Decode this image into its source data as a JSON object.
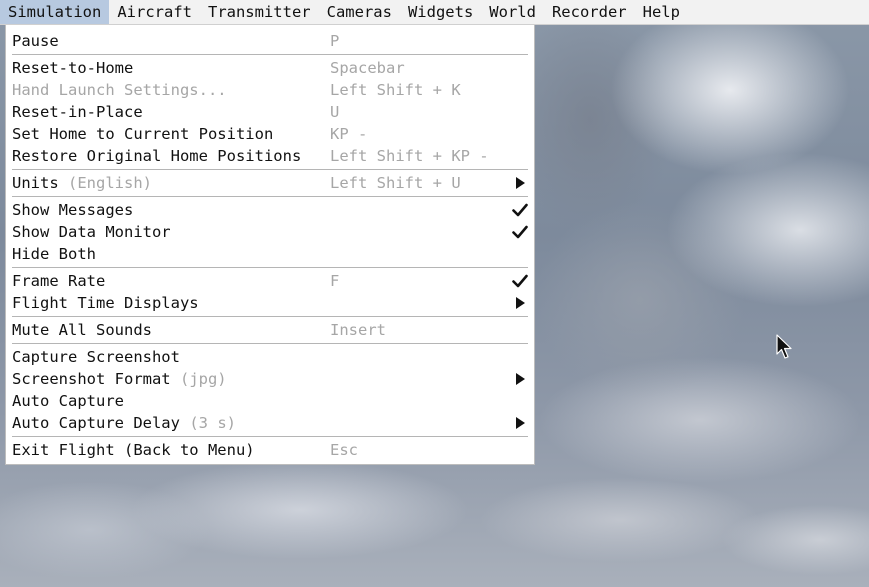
{
  "menubar": {
    "items": [
      {
        "label": "Simulation"
      },
      {
        "label": "Aircraft"
      },
      {
        "label": "Transmitter"
      },
      {
        "label": "Cameras"
      },
      {
        "label": "Widgets"
      },
      {
        "label": "World"
      },
      {
        "label": "Recorder"
      },
      {
        "label": "Help"
      }
    ]
  },
  "menu": {
    "pause": {
      "label": "Pause",
      "shortcut": "P"
    },
    "reset_home": {
      "label": "Reset-to-Home",
      "shortcut": "Spacebar"
    },
    "hand_launch": {
      "label": "Hand Launch Settings...",
      "shortcut": "Left Shift + K"
    },
    "reset_place": {
      "label": "Reset-in-Place",
      "shortcut": "U"
    },
    "set_home": {
      "label": "Set Home to Current Position",
      "shortcut": "KP -"
    },
    "restore_home": {
      "label": "Restore Original Home Positions",
      "shortcut": "Left Shift + KP -"
    },
    "units": {
      "label": "Units",
      "note": "(English)",
      "shortcut": "Left Shift + U"
    },
    "show_messages": {
      "label": "Show Messages"
    },
    "show_data_monitor": {
      "label": "Show Data Monitor"
    },
    "hide_both": {
      "label": "Hide Both"
    },
    "frame_rate": {
      "label": "Frame Rate",
      "shortcut": "F"
    },
    "flight_time": {
      "label": "Flight Time Displays"
    },
    "mute": {
      "label": "Mute All Sounds",
      "shortcut": "Insert"
    },
    "capture": {
      "label": "Capture Screenshot"
    },
    "screenshot_format": {
      "label": "Screenshot Format",
      "note": "(jpg)"
    },
    "auto_capture": {
      "label": "Auto Capture"
    },
    "auto_capture_delay": {
      "label": "Auto Capture Delay",
      "note": "(3 s)"
    },
    "exit": {
      "label": "Exit Flight (Back to Menu)",
      "shortcut": "Esc"
    }
  },
  "icons": {
    "check": "check-icon",
    "submenu": "submenu-arrow-icon",
    "cursor": "mouse-pointer-icon"
  },
  "colors": {
    "menubar_bg": "#f2f2f2",
    "active_menu_bg": "#b7c9e0",
    "menu_bg": "#ffffff",
    "disabled_text": "#a6a6a6"
  }
}
